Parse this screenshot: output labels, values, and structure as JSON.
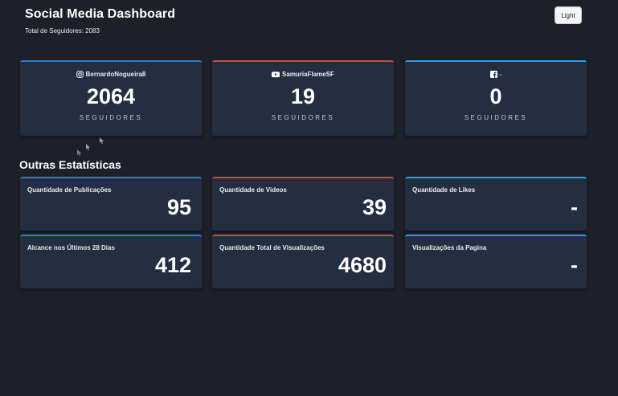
{
  "header": {
    "title": "Social Media Dashboard",
    "total_label": "Total de Seguidores: 2083",
    "theme_toggle_label": "Light"
  },
  "accounts": [
    {
      "platform_icon": "instagram-icon",
      "handle": "BernardoNogueira8",
      "count": "2064",
      "label": "SEGUIDORES",
      "accent": "#2f7de1"
    },
    {
      "platform_icon": "youtube-icon",
      "handle": "SamuriaFlameSF",
      "count": "19",
      "label": "SEGUIDORES",
      "accent": "#d24a4a"
    },
    {
      "platform_icon": "facebook-icon",
      "handle": "-",
      "count": "0",
      "label": "SEGUIDORES",
      "accent": "#1aa7ec"
    }
  ],
  "other_stats": {
    "title": "Outras Estatísticas",
    "items": [
      {
        "label": "Quantidade de Publicações",
        "value": "95"
      },
      {
        "label": "Quantidade de Videos",
        "value": "39"
      },
      {
        "label": "Quantidade de Likes",
        "value": "-"
      },
      {
        "label": "Alcance nos Últimos 28 Dias",
        "value": "412"
      },
      {
        "label": "Quantidade Total de Visualizações",
        "value": "4680"
      },
      {
        "label": "Visualizações da Pagina",
        "value": "-"
      }
    ]
  },
  "colors": {
    "background": "#1d2029",
    "card": "#252d40",
    "instagram_accent": "#2f7de1",
    "youtube_accent": "#d24a4a",
    "facebook_accent": "#1aa7ec"
  }
}
